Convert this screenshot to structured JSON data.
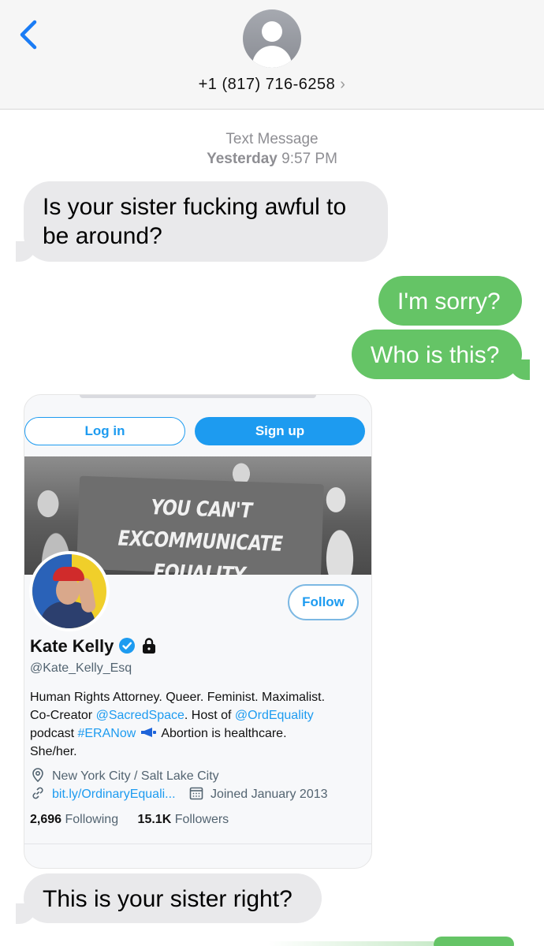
{
  "header": {
    "back_icon": "chevron-left-icon",
    "contact_avatar_icon": "person-icon",
    "contact_number": "+1 (817) 716-6258",
    "contact_chevron": "›"
  },
  "timestamp": {
    "service": "Text Message",
    "day": "Yesterday",
    "time": "9:57 PM"
  },
  "messages": [
    {
      "direction": "received",
      "text_line1": "Is your sister fucking awful to",
      "text_line2": "be around?"
    },
    {
      "direction": "sent",
      "text": "I'm sorry?"
    },
    {
      "direction": "sent",
      "text": "Who is this?"
    },
    {
      "direction": "received",
      "text": "This is your sister right?"
    }
  ],
  "card": {
    "login_label": "Log in",
    "signup_label": "Sign up",
    "banner_text_line1": "YOU CAN'T EXCOMMUNICATE",
    "banner_text_line2": "EQUALITY",
    "follow_label": "Follow",
    "name": "Kate Kelly",
    "handle": "@Kate_Kelly_Esq",
    "bio": {
      "line1": "Human Rights Attorney. Queer. Feminist. Maximalist.",
      "line2_pre": "Co-Creator ",
      "line2_link1": "@SacredSpace",
      "line2_mid": ". Host of ",
      "line2_link2": "@OrdEquality",
      "line3_pre": " podcast ",
      "line3_link": "#ERANow",
      "line3_post": " Abortion is healthcare.",
      "line4": "She/her."
    },
    "location": "New York City / Salt Lake City",
    "website": "bit.ly/OrdinaryEquali...",
    "joined": "Joined January 2013",
    "following_count": "2,696",
    "following_label": "Following",
    "followers_count": "15.1K",
    "followers_label": "Followers"
  },
  "colors": {
    "sent_bubble": "#65c466",
    "received_bubble": "#e9e9eb",
    "ios_blue": "#1a7cf5",
    "twitter_blue": "#1d9bf0"
  }
}
